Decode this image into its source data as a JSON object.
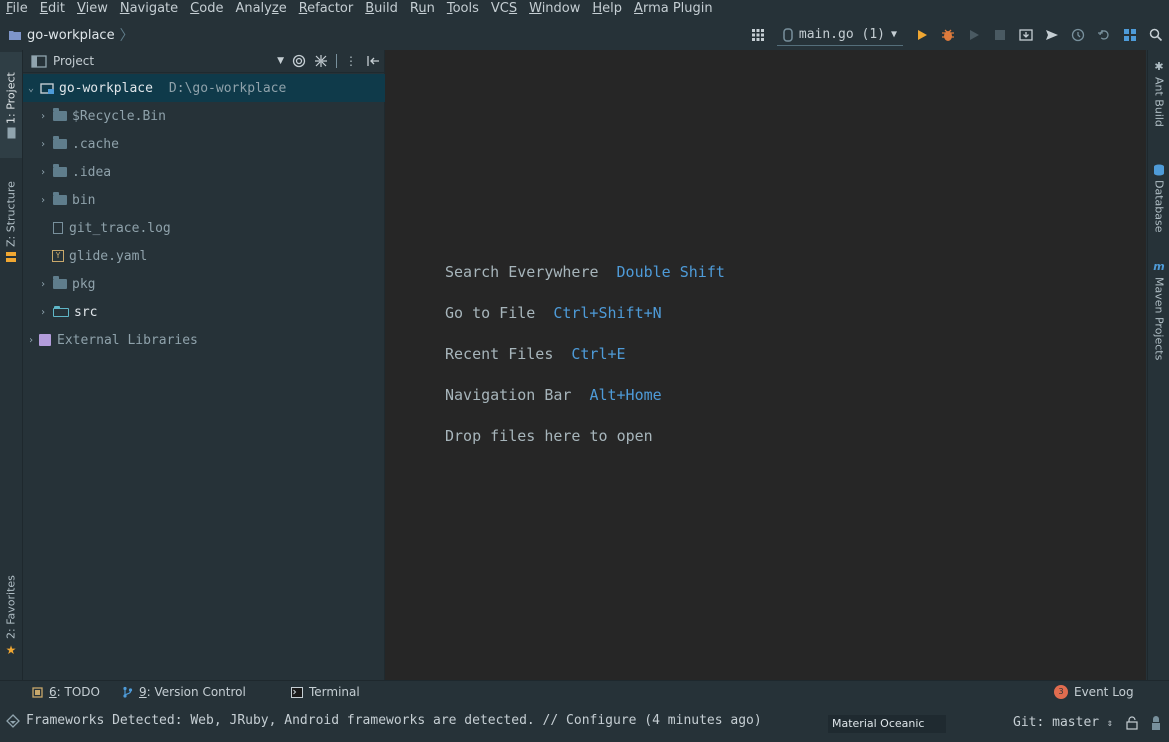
{
  "menubar": {
    "items": [
      {
        "mn": "F",
        "rest": "ile"
      },
      {
        "mn": "E",
        "rest": "dit"
      },
      {
        "mn": "V",
        "rest": "iew"
      },
      {
        "mn": "N",
        "rest": "avigate"
      },
      {
        "mn": "C",
        "rest": "ode"
      },
      {
        "pre": "Analy",
        "mn": "z",
        "rest": "e"
      },
      {
        "mn": "R",
        "rest": "efactor"
      },
      {
        "mn": "B",
        "rest": "uild"
      },
      {
        "pre": "R",
        "mn": "u",
        "rest": "n"
      },
      {
        "mn": "T",
        "rest": "ools"
      },
      {
        "pre": "VC",
        "mn": "S",
        "rest": ""
      },
      {
        "mn": "W",
        "rest": "indow"
      },
      {
        "mn": "H",
        "rest": "elp"
      },
      {
        "mn": "A",
        "rest": "rma Plugin"
      }
    ]
  },
  "navbar": {
    "project": "go-workplace",
    "run_config": "main.go (1)"
  },
  "left_strip": {
    "project_tab": "1: Project",
    "structure_tab": "Z: Structure",
    "favorites_tab": "2: Favorites"
  },
  "right_strip": {
    "ant_tab": "Ant Build",
    "database_tab": "Database",
    "maven_tab": "Maven Projects"
  },
  "project_panel": {
    "title": "Project",
    "root": {
      "name": "go-workplace",
      "path": "D:\\go-workplace"
    },
    "items": [
      {
        "name": "$Recycle.Bin"
      },
      {
        "name": ".cache"
      },
      {
        "name": ".idea"
      },
      {
        "name": "bin"
      },
      {
        "name": "git_trace.log"
      },
      {
        "name": "glide.yaml"
      },
      {
        "name": "pkg"
      },
      {
        "name": "src"
      }
    ],
    "external": "External Libraries",
    "yaml_icon_letter": "Y"
  },
  "editor": {
    "hints": [
      {
        "label": "Search Everywhere",
        "key": "Double Shift"
      },
      {
        "label": "Go to File",
        "key": "Ctrl+Shift+N"
      },
      {
        "label": "Recent Files",
        "key": "Ctrl+E"
      },
      {
        "label": "Navigation Bar",
        "key": "Alt+Home"
      }
    ],
    "drop_text": "Drop files here to open"
  },
  "bottom_bar": {
    "todo_num": "6",
    "todo_label": ": TODO",
    "vc_num": "9",
    "vc_label": ": Version Control",
    "terminal": "Terminal",
    "event_count": "3",
    "event_log": "Event Log"
  },
  "status_bar": {
    "message": "Frameworks Detected: Web, JRuby, Android frameworks are detected. // Configure (4 minutes ago)",
    "theme": "Material Oceanic",
    "git": "Git: master"
  },
  "colors": {
    "background": "#263238",
    "editor": "#262626",
    "selection": "#0f3a4a",
    "accent_key": "#4e9bd8",
    "run": "#f0a732",
    "event_badge": "#e06c4f"
  }
}
